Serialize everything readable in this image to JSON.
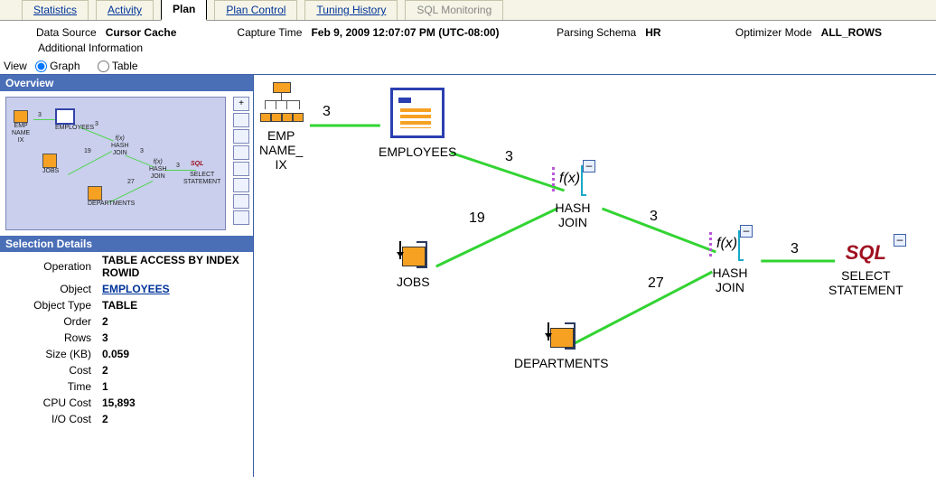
{
  "tabs": {
    "statistics": "Statistics",
    "activity": "Activity",
    "plan": "Plan",
    "plan_control": "Plan Control",
    "tuning_history": "Tuning History",
    "sql_monitoring": "SQL Monitoring"
  },
  "info": {
    "data_source_label": "Data Source",
    "data_source_value": "Cursor Cache",
    "capture_time_label": "Capture Time",
    "capture_time_value": "Feb 9, 2009 12:07:07 PM (UTC-08:00)",
    "parsing_schema_label": "Parsing Schema",
    "parsing_schema_value": "HR",
    "optimizer_mode_label": "Optimizer Mode",
    "optimizer_mode_value": "ALL_ROWS",
    "additional_info": "Additional Information"
  },
  "view": {
    "label": "View",
    "opt_graph": "Graph",
    "opt_table": "Table"
  },
  "panels": {
    "overview": "Overview",
    "selection": "Selection Details"
  },
  "zoom": {
    "plus": "+"
  },
  "selection": {
    "operation_k": "Operation",
    "operation_v": "TABLE ACCESS BY INDEX ROWID",
    "object_k": "Object",
    "object_v": "EMPLOYEES",
    "objtype_k": "Object Type",
    "objtype_v": "TABLE",
    "order_k": "Order",
    "order_v": "2",
    "rows_k": "Rows",
    "rows_v": "3",
    "size_k": "Size (KB)",
    "size_v": "0.059",
    "cost_k": "Cost",
    "cost_v": "2",
    "time_k": "Time",
    "time_v": "1",
    "cpu_k": "CPU Cost",
    "cpu_v": "15,893",
    "io_k": "I/O Cost",
    "io_v": "2"
  },
  "graph": {
    "emp_ix": "EMP\nNAME_\nIX",
    "employees": "EMPLOYEES",
    "jobs": "JOBS",
    "departments": "DEPARTMENTS",
    "hash_join": "HASH\nJOIN",
    "select_stmt": "SELECT\nSTATEMENT",
    "sql": "SQL",
    "e1": "3",
    "e2": "3",
    "e3": "19",
    "e4": "3",
    "e5": "27",
    "e6": "3",
    "minus": "–"
  },
  "ov": {
    "emp_ix": "EMP\nNAME\nIX",
    "employees": "EMPLOYEES",
    "jobs": "JOBS",
    "departments": "DEPARTMENTS",
    "hash": "HASH\nJOIN",
    "select": "SELECT\nSTATEMENT",
    "sql": "SQL",
    "n3": "3",
    "n19": "19",
    "n27": "27"
  }
}
